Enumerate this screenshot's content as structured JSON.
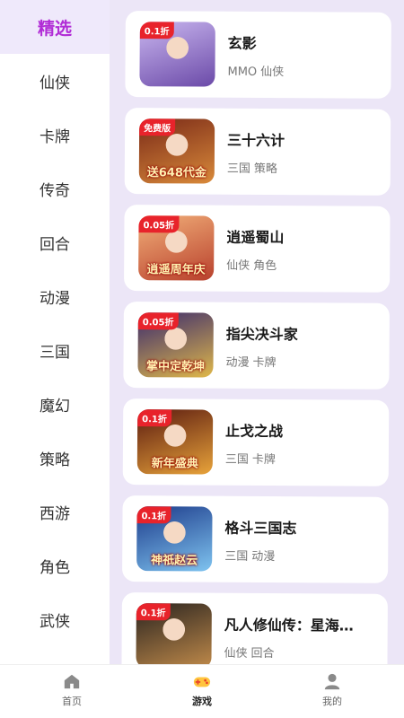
{
  "sidebar": {
    "categories": [
      {
        "label": "精选",
        "active": true
      },
      {
        "label": "仙侠"
      },
      {
        "label": "卡牌"
      },
      {
        "label": "传奇"
      },
      {
        "label": "回合"
      },
      {
        "label": "动漫"
      },
      {
        "label": "三国"
      },
      {
        "label": "魔幻"
      },
      {
        "label": "策略"
      },
      {
        "label": "西游"
      },
      {
        "label": "角色"
      },
      {
        "label": "武侠"
      }
    ]
  },
  "games": [
    {
      "title": "玄影",
      "tags": [
        "MMO",
        "仙侠"
      ],
      "badge": "0.1折",
      "caption": "",
      "colors": [
        "#c9b6ef",
        "#6b4aa8"
      ]
    },
    {
      "title": "三十六计",
      "tags": [
        "三国",
        "策略"
      ],
      "badge": "免费版",
      "caption": "送648代金",
      "colors": [
        "#7a2a18",
        "#d98a3a"
      ]
    },
    {
      "title": "逍遥蜀山",
      "tags": [
        "仙侠",
        "角色"
      ],
      "badge": "0.05折",
      "caption": "逍遥周年庆",
      "colors": [
        "#f2b07a",
        "#b8402c"
      ]
    },
    {
      "title": "指尖决斗家",
      "tags": [
        "动漫",
        "卡牌"
      ],
      "badge": "0.05折",
      "caption": "掌中定乾坤",
      "colors": [
        "#3a2a6e",
        "#e0b84a"
      ]
    },
    {
      "title": "止戈之战",
      "tags": [
        "三国",
        "卡牌"
      ],
      "badge": "0.1折",
      "caption": "新年盛典",
      "colors": [
        "#5a1a10",
        "#e8a33a"
      ]
    },
    {
      "title": "格斗三国志",
      "tags": [
        "三国",
        "动漫"
      ],
      "badge": "0.1折",
      "caption": "神祇赵云",
      "colors": [
        "#1c3a8a",
        "#7fc4f0"
      ]
    },
    {
      "title": "凡人修仙传：星海飞驰",
      "tags": [
        "仙侠",
        "回合"
      ],
      "badge": "0.1折",
      "caption": "",
      "colors": [
        "#2a2420",
        "#c08a4a"
      ]
    }
  ],
  "bottomnav": {
    "home": "首页",
    "games": "游戏",
    "mine": "我的"
  }
}
